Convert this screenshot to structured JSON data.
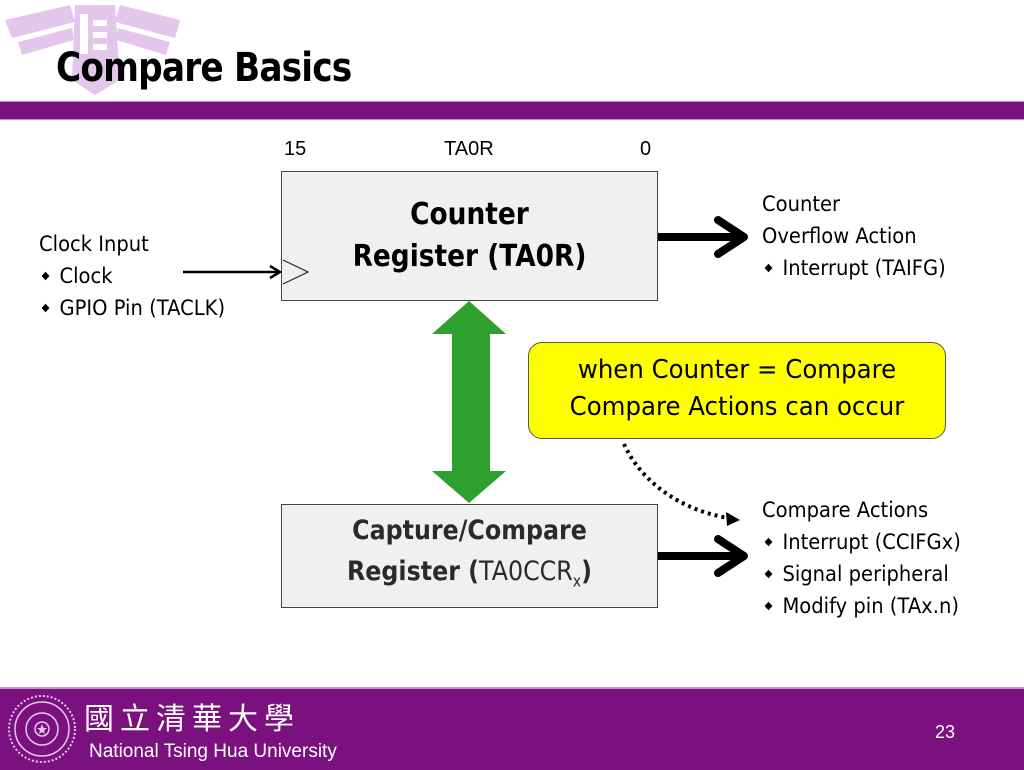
{
  "slide": {
    "title": "Compare Basics",
    "page_number": "23"
  },
  "colors": {
    "brand_purple": "#7b107f",
    "callout_yellow": "#ffff00",
    "arrow_green": "#2ea02e",
    "box_fill": "#f0f0f0"
  },
  "counter_register": {
    "bit_high": "15",
    "name_label": "TA0R",
    "bit_low": "0",
    "line1": "Counter",
    "line2": "Register (TA0R)"
  },
  "clock_input": {
    "heading": "Clock Input",
    "items": [
      "Clock",
      "GPIO Pin (TACLK)"
    ]
  },
  "overflow_action": {
    "line1": "Counter",
    "line2": "Overflow Action",
    "items": [
      "Interrupt (TAIFG)"
    ]
  },
  "callout": {
    "line1": "when Counter = Compare",
    "line2": "Compare Actions can occur"
  },
  "capture_compare_register": {
    "line1": "Capture/Compare",
    "line2_prefix": "Register (",
    "line2_reg": "TA0CCR",
    "line2_sub": "x",
    "line2_suffix": ")"
  },
  "compare_actions": {
    "heading": "Compare Actions",
    "items": [
      "Interrupt (CCIFGx)",
      "Signal peripheral",
      "Modify pin (TAx.n)"
    ]
  },
  "footer": {
    "university_cn": "國立清華大學",
    "university_en": "National Tsing Hua University"
  },
  "icons": {
    "watermark": "university-building-logo",
    "seal": "university-seal"
  }
}
